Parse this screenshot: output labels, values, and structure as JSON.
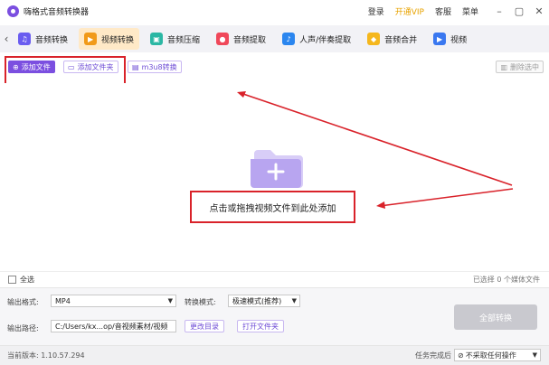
{
  "app": {
    "title": "嗨格式音频转换器"
  },
  "titlebar": {
    "login": "登录",
    "vip": "开通VIP",
    "service": "客服",
    "menu": "菜单"
  },
  "tabs": [
    {
      "label": "音频转换",
      "icon": "headphones-icon",
      "color": "#6a5cf0"
    },
    {
      "label": "视频转换",
      "icon": "video-icon",
      "color": "#f19a1a",
      "active": true
    },
    {
      "label": "音频压缩",
      "icon": "compress-icon",
      "color": "#2bb7a4"
    },
    {
      "label": "音频提取",
      "icon": "microphone-icon",
      "color": "#f0485a"
    },
    {
      "label": "人声/伴奏提取",
      "icon": "person-voice-icon",
      "color": "#2b86ef"
    },
    {
      "label": "音频合并",
      "icon": "merge-icon",
      "color": "#f5b71d"
    },
    {
      "label": "视频",
      "icon": "video-icon",
      "color": "#3a78f0"
    }
  ],
  "toolbar": {
    "add_file": "添加文件",
    "add_folder": "添加文件夹",
    "m3u8": "m3u8转换",
    "delete": "删除选中"
  },
  "dropzone": {
    "hint": "点击或拖拽视频文件到此处添加"
  },
  "selection": {
    "select_all": "全选",
    "count": "已选择 0 个媒体文件"
  },
  "output": {
    "format_label": "输出格式:",
    "format_value": "MP4",
    "mode_label": "转换模式:",
    "mode_value": "极速模式(推荐)",
    "path_label": "输出路径:",
    "path_value": "C:/Users/kx...op/音视频素材/视频",
    "change_dir": "更改目录",
    "open_folder": "打开文件夹",
    "convert_all": "全部转换"
  },
  "status": {
    "version": "当前版本: 1.10.57.294",
    "after_label": "任务完成后",
    "after_value": "不采取任何操作"
  },
  "colors": {
    "accent": "#7b4fe0",
    "highlight": "#d9222a",
    "active_tab": "#ffe9c7"
  }
}
